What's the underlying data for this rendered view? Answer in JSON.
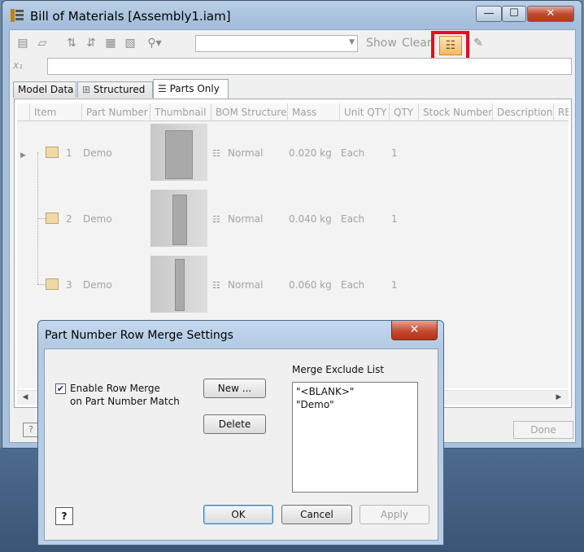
{
  "window": {
    "title": "Bill of Materials [Assembly1.iam]",
    "minimize": "—",
    "maximize": "☐",
    "close": "✕"
  },
  "toolbar": {
    "show_label": "Show",
    "clear_label": "Clear",
    "combo_value": "",
    "formula_value": ""
  },
  "tabs": [
    {
      "label": "Model Data"
    },
    {
      "label": "Structured"
    },
    {
      "label": "Parts Only"
    }
  ],
  "grid": {
    "columns": [
      "Item",
      "Part Number",
      "Thumbnail",
      "BOM Structure",
      "Mass",
      "Unit QTY",
      "QTY",
      "Stock Number",
      "Description",
      "REV"
    ],
    "rows": [
      {
        "item": "1",
        "part_number": "Demo",
        "bom_structure": "Normal",
        "mass": "0.020 kg",
        "unit_qty": "Each",
        "qty": "1"
      },
      {
        "item": "2",
        "part_number": "Demo",
        "bom_structure": "Normal",
        "mass": "0.040 kg",
        "unit_qty": "Each",
        "qty": "1"
      },
      {
        "item": "3",
        "part_number": "Demo",
        "bom_structure": "Normal",
        "mass": "0.060 kg",
        "unit_qty": "Each",
        "qty": "1"
      }
    ]
  },
  "footer": {
    "help": "?",
    "done_label": "Done"
  },
  "dialog": {
    "title": "Part Number Row Merge Settings",
    "close": "✕",
    "checkbox_label_line1": "Enable Row Merge",
    "checkbox_label_line2": "on Part Number Match",
    "checkbox_checked": true,
    "new_label": "New ...",
    "delete_label": "Delete",
    "exclude_list_label": "Merge Exclude List",
    "exclude_list": [
      "\"<BLANK>\"",
      "\"Demo\""
    ],
    "ok_label": "OK",
    "cancel_label": "Cancel",
    "apply_label": "Apply",
    "help": "?"
  },
  "colors": {
    "highlight": "#e30f1b",
    "title_bar": "#a9c2de",
    "close_button": "#c24a30"
  }
}
